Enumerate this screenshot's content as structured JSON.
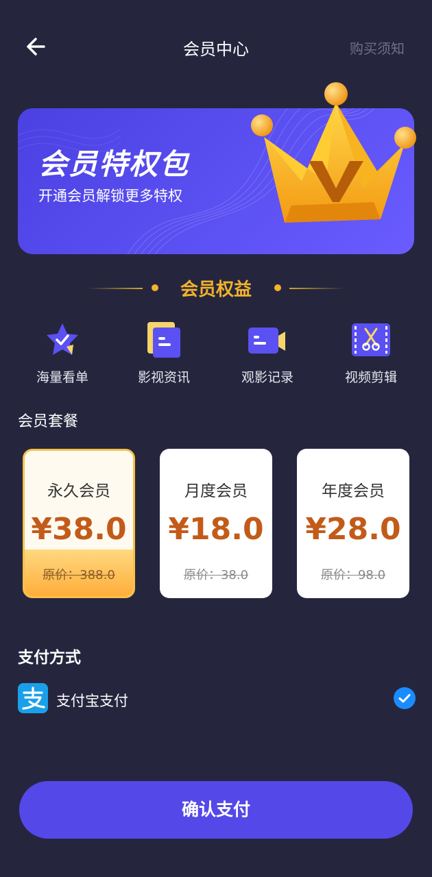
{
  "header": {
    "title": "会员中心",
    "notice_label": "购买须知"
  },
  "banner": {
    "title": "会员特权包",
    "subtitle": "开通会员解锁更多特权",
    "crown_letter": "V"
  },
  "benefits": {
    "heading": "会员权益",
    "items": [
      {
        "label": "海量看单",
        "icon": "star-check-icon"
      },
      {
        "label": "影视资讯",
        "icon": "news-card-icon"
      },
      {
        "label": "观影记录",
        "icon": "video-camera-icon"
      },
      {
        "label": "视频剪辑",
        "icon": "film-scissors-icon"
      }
    ]
  },
  "plans": {
    "title": "会员套餐",
    "items": [
      {
        "name": "永久会员",
        "price": "¥38.0",
        "orig_prefix": "原价：",
        "orig": "388.0",
        "selected": true
      },
      {
        "name": "月度会员",
        "price": "¥18.0",
        "orig_prefix": "原价：",
        "orig": "38.0",
        "selected": false
      },
      {
        "name": "年度会员",
        "price": "¥28.0",
        "orig_prefix": "原价：",
        "orig": "98.0",
        "selected": false
      }
    ]
  },
  "payment": {
    "title": "支付方式",
    "method_label": "支付宝支付",
    "method_icon": "alipay-icon",
    "checked": true
  },
  "confirm": {
    "label": "确认支付"
  },
  "colors": {
    "background": "#25263e",
    "accent": "#5548e8",
    "gold": "#f3b32a",
    "price": "#c25b1a"
  }
}
